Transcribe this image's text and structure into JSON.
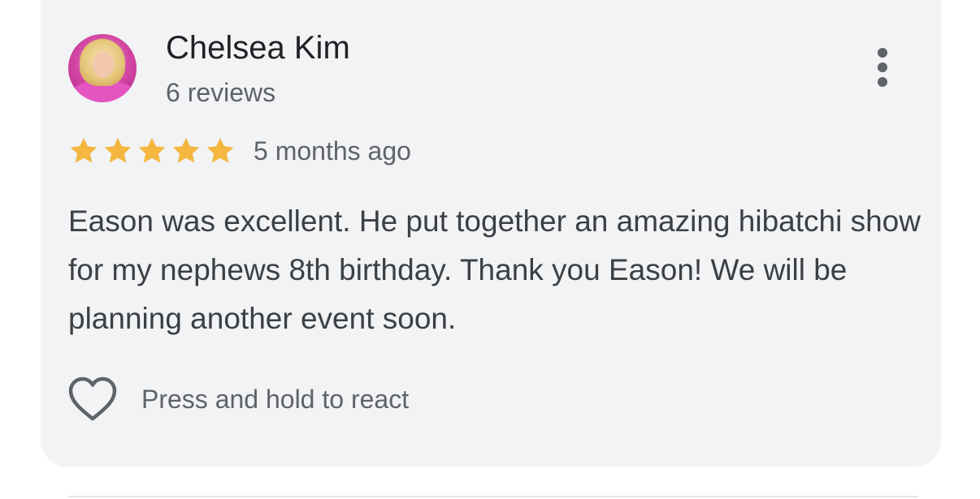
{
  "review": {
    "reviewer_name": "Chelsea Kim",
    "reviewer_review_count": "6 reviews",
    "rating": 5,
    "rating_max": 5,
    "time_ago": "5 months ago",
    "text": "Eason was excellent. He put together an amazing hibatchi show for my nephews 8th birthday. Thank you Eason! We will be planning another event soon.",
    "react_label": "Press and hold to react"
  },
  "icons": {
    "avatar": "avatar",
    "star": "star-icon",
    "more": "more-vert-icon",
    "heart": "heart-outline-icon"
  },
  "colors": {
    "card_background": "#f2f3f5",
    "star": "#f4b73f",
    "name_text": "#202124",
    "secondary_text": "#5f6368",
    "body_text": "#3c4043",
    "icon": "#5f6368"
  }
}
